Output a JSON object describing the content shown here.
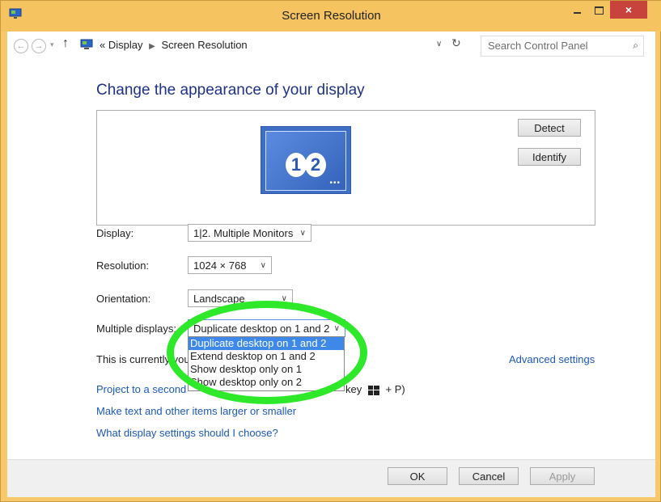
{
  "window": {
    "title": "Screen Resolution",
    "close_glyph": "×"
  },
  "address": {
    "crumb_prefix": "«",
    "crumbs": [
      "Display",
      "Screen Resolution"
    ],
    "search_placeholder": "Search Control Panel"
  },
  "heading": "Change the appearance of your display",
  "preview": {
    "monitor_numbers": [
      "1",
      "2"
    ],
    "detect_label": "Detect",
    "identify_label": "Identify"
  },
  "fields": {
    "display": {
      "label": "Display:",
      "value": "1|2. Multiple Monitors"
    },
    "resolution": {
      "label": "Resolution:",
      "value": "1024 × 768"
    },
    "orientation": {
      "label": "Orientation:",
      "value": "Landscape"
    },
    "multiple": {
      "label": "Multiple displays:",
      "value": "Duplicate desktop on 1 and 2",
      "options": [
        "Duplicate desktop on 1 and 2",
        "Extend desktop on 1 and 2",
        "Show desktop only on 1",
        "Show desktop only on 2"
      ],
      "selected_index": 0
    }
  },
  "info_text": "This is currently you",
  "links": {
    "advanced": "Advanced settings",
    "project": "Project to a second",
    "project_tail_key": "key",
    "project_tail_end": "+ P)",
    "text_size": "Make text and other items larger or smaller",
    "what_settings": "What display settings should I choose?"
  },
  "footer": {
    "ok": "OK",
    "cancel": "Cancel",
    "apply": "Apply"
  },
  "colors": {
    "titlebar": "#f5c460",
    "selection": "#3d88e8",
    "link": "#1c59b5",
    "highlight": "#2ee82a",
    "close": "#c7433b"
  }
}
